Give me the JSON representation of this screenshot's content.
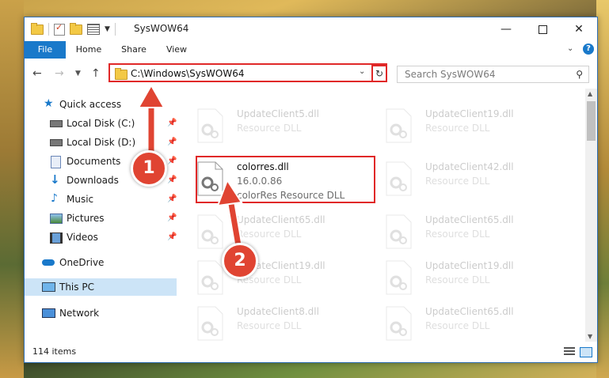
{
  "window": {
    "title": "SysWOW64",
    "minimize_glyph": "—",
    "close_glyph": "✕"
  },
  "ribbon": {
    "tabs": [
      {
        "label": "File"
      },
      {
        "label": "Home"
      },
      {
        "label": "Share"
      },
      {
        "label": "View"
      }
    ],
    "help_glyph": "?"
  },
  "address": {
    "path": "C:\\Windows\\SysWOW64",
    "search_placeholder": "Search SysWOW64"
  },
  "sidebar": {
    "items": [
      {
        "label": "Quick access",
        "icon": "star-icon"
      },
      {
        "label": "Local Disk (C:)",
        "icon": "drive-icon",
        "pinned": true
      },
      {
        "label": "Local Disk (D:)",
        "icon": "drive-icon",
        "pinned": true
      },
      {
        "label": "Documents",
        "icon": "documents-icon",
        "pinned": true
      },
      {
        "label": "Downloads",
        "icon": "download-icon",
        "pinned": true
      },
      {
        "label": "Music",
        "icon": "music-icon",
        "pinned": true
      },
      {
        "label": "Pictures",
        "icon": "pictures-icon",
        "pinned": true
      },
      {
        "label": "Videos",
        "icon": "videos-icon",
        "pinned": true
      },
      {
        "label": "OneDrive",
        "icon": "cloud-icon"
      },
      {
        "label": "This PC",
        "icon": "computer-icon",
        "selected": true
      },
      {
        "label": "Network",
        "icon": "network-icon"
      }
    ]
  },
  "files": {
    "left_column": [
      {
        "name": "UpdateClient5.dll",
        "line1": "Resource DLL",
        "line2": ""
      },
      {
        "name": "colorres.dll",
        "line1": "16.0.0.86",
        "line2": "colorRes Resource DLL",
        "highlighted": true
      },
      {
        "name": "UpdateClient65.dll",
        "line1": "Resource DLL",
        "line2": ""
      },
      {
        "name": "UpdateClient19.dll",
        "line1": "Resource DLL",
        "line2": ""
      },
      {
        "name": "UpdateClient8.dll",
        "line1": "Resource DLL",
        "line2": ""
      }
    ],
    "right_column": [
      {
        "name": "UpdateClient19.dll",
        "line1": "Resource DLL"
      },
      {
        "name": "UpdateClient42.dll",
        "line1": "Resource DLL"
      },
      {
        "name": "UpdateClient65.dll",
        "line1": "Resource DLL"
      },
      {
        "name": "UpdateClient19.dll",
        "line1": "Resource DLL"
      },
      {
        "name": "UpdateClient65.dll",
        "line1": "Resource DLL"
      }
    ]
  },
  "status": {
    "item_count": "114 items"
  },
  "annotations": {
    "step1": "1",
    "step2": "2",
    "color": "#e04432"
  },
  "colors": {
    "accent": "#1979ca",
    "highlight": "#e02828"
  }
}
